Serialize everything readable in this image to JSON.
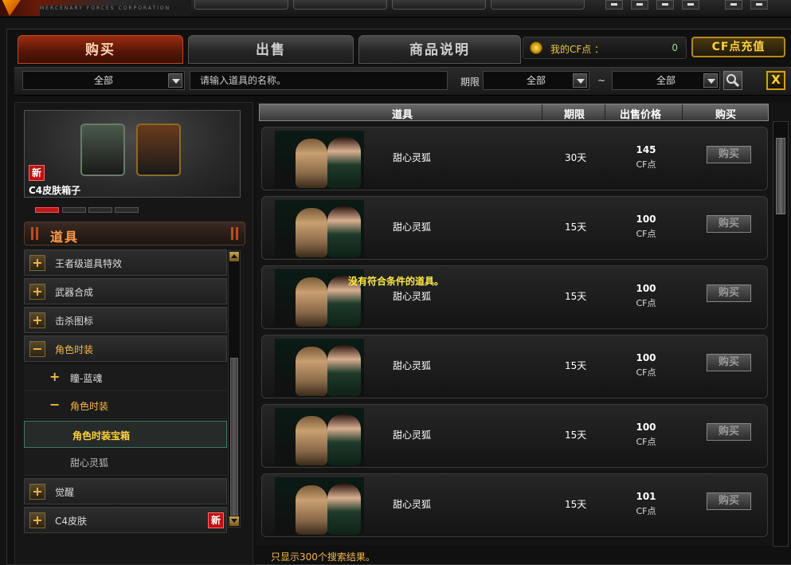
{
  "logo": {
    "subtitle": "MERCENARY FORCES CORPORATION"
  },
  "tabs": [
    {
      "label": "购买",
      "active": true
    },
    {
      "label": "出售",
      "active": false
    },
    {
      "label": "商品说明",
      "active": false
    }
  ],
  "cf": {
    "label": "我的CF点 ：",
    "value": "0",
    "recharge": "CF点充值"
  },
  "filter": {
    "category": "全部",
    "search_placeholder": "请输入道具的名称。",
    "period_label": "期限",
    "period_from": "全部",
    "tilde": "~",
    "period_to": "全部",
    "close": "X"
  },
  "preview": {
    "badge": "新",
    "name": "C4皮肤箱子"
  },
  "categories_header": "道具",
  "categories": [
    {
      "label": "王者级道具特效",
      "sign": "+"
    },
    {
      "label": "武器合成",
      "sign": "+"
    },
    {
      "label": "击杀图标",
      "sign": "+"
    },
    {
      "label": "角色时装",
      "sign": "−"
    }
  ],
  "subcategories": [
    {
      "label": "瞳-蓝魂",
      "sign": "+"
    },
    {
      "label": "角色时装",
      "sign": "−"
    },
    {
      "label": "角色时装宝箱",
      "sign": ""
    },
    {
      "label": "甜心灵狐",
      "sign": ""
    }
  ],
  "categories_bottom": [
    {
      "label": "觉醒",
      "sign": "+"
    },
    {
      "label": "C4皮肤",
      "sign": "+",
      "badge": "新"
    }
  ],
  "columns": {
    "item": "道具",
    "period": "期限",
    "price": "出售价格",
    "buy": "购买"
  },
  "rows": [
    {
      "name": "甜心灵狐",
      "period": "30天",
      "price": "145",
      "unit": "CF点",
      "buy": "购买"
    },
    {
      "name": "甜心灵狐",
      "period": "15天",
      "price": "100",
      "unit": "CF点",
      "buy": "购买"
    },
    {
      "name": "甜心灵狐",
      "period": "15天",
      "price": "100",
      "unit": "CF点",
      "buy": "购买"
    },
    {
      "name": "甜心灵狐",
      "period": "15天",
      "price": "100",
      "unit": "CF点",
      "buy": "购买"
    },
    {
      "name": "甜心灵狐",
      "period": "15天",
      "price": "100",
      "unit": "CF点",
      "buy": "购买"
    },
    {
      "name": "甜心灵狐",
      "period": "15天",
      "price": "101",
      "unit": "CF点",
      "buy": "购买"
    }
  ],
  "no_item_message": "没有符合条件的道具。",
  "footer": "只显示300个搜索结果。"
}
